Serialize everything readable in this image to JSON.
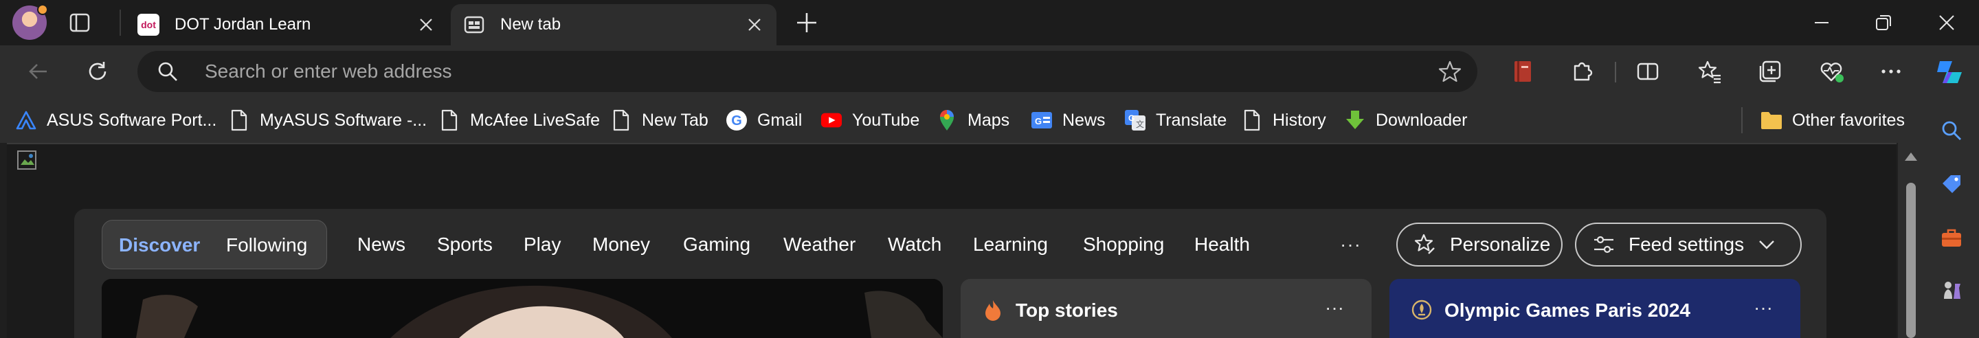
{
  "tabs": [
    {
      "title": "DOT Jordan Learn",
      "favicon": "dot-logo-icon",
      "favicon_text": "dot",
      "active": false
    },
    {
      "title": "New tab",
      "favicon": "newtab-page-icon",
      "active": true
    }
  ],
  "address_bar": {
    "placeholder": "Search or enter web address",
    "value": ""
  },
  "favorites": [
    {
      "label": "ASUS Software Port...",
      "icon": "asus-logo-icon"
    },
    {
      "label": "MyASUS Software -...",
      "icon": "page-icon"
    },
    {
      "label": "McAfee LiveSafe",
      "icon": "page-icon"
    },
    {
      "label": "New Tab",
      "icon": "page-icon"
    },
    {
      "label": "Gmail",
      "icon": "google-g-icon"
    },
    {
      "label": "YouTube",
      "icon": "youtube-icon"
    },
    {
      "label": "Maps",
      "icon": "maps-pin-icon"
    },
    {
      "label": "News",
      "icon": "google-news-icon"
    },
    {
      "label": "Translate",
      "icon": "google-translate-icon"
    },
    {
      "label": "History",
      "icon": "page-icon"
    },
    {
      "label": "Downloader",
      "icon": "download-arrow-icon"
    }
  ],
  "other_favorites": {
    "label": "Other favorites",
    "icon": "folder-icon"
  },
  "feed": {
    "segments": [
      {
        "label": "Discover",
        "selected": true
      },
      {
        "label": "Following",
        "selected": false
      }
    ],
    "nav": [
      "News",
      "Sports",
      "Play",
      "Money",
      "Gaming",
      "Weather",
      "Watch",
      "Learning",
      "Shopping",
      "Health"
    ],
    "more": "···",
    "personalize_label": "Personalize",
    "feed_settings_label": "Feed settings"
  },
  "cards": {
    "top_stories": {
      "title": "Top stories",
      "more": "···"
    },
    "olympics": {
      "title": "Olympic Games Paris 2024",
      "more": "···"
    }
  },
  "colors": {
    "accent_blue": "#8cb4ff",
    "olympic_card": "#1d2a6b",
    "youtube_red": "#ff0000",
    "downloader_green": "#6fc23a"
  }
}
